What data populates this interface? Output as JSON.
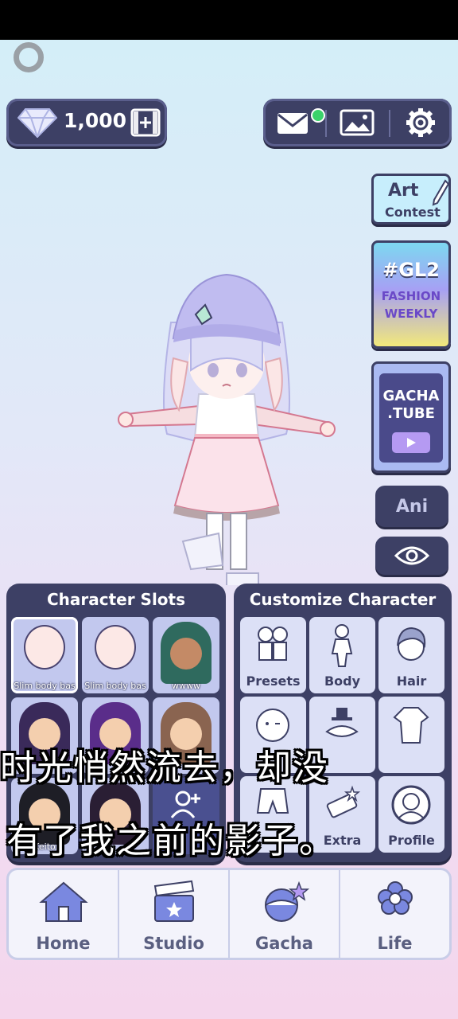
{
  "currency": {
    "amount": "1,000"
  },
  "side": {
    "art_contest": [
      "Art",
      "Contest"
    ],
    "gl2": {
      "tag": "#GL2",
      "line1": "FASHION",
      "line2": "WEEKLY"
    },
    "gachatube": [
      "GACHA",
      ".TUBE"
    ],
    "ani": "Ani"
  },
  "slots": {
    "title": "Character Slots",
    "items": [
      "Slim body bas",
      "Slim body bas",
      "wwww",
      "",
      "",
      "",
      "Keito",
      "",
      ""
    ]
  },
  "customize": {
    "title": "Customize Character",
    "items": [
      "Presets",
      "Body",
      "Hair",
      "",
      "",
      "",
      "",
      "Extra",
      "Profile"
    ]
  },
  "nav": [
    "Home",
    "Studio",
    "Gacha",
    "Life"
  ],
  "subtitle": {
    "line1": "时光悄然流去，却没",
    "line2": "有了我之前的影子。"
  },
  "colors": {
    "panel": "#3d4065",
    "accent": "#b59af2",
    "notification": "#3ad26a"
  }
}
